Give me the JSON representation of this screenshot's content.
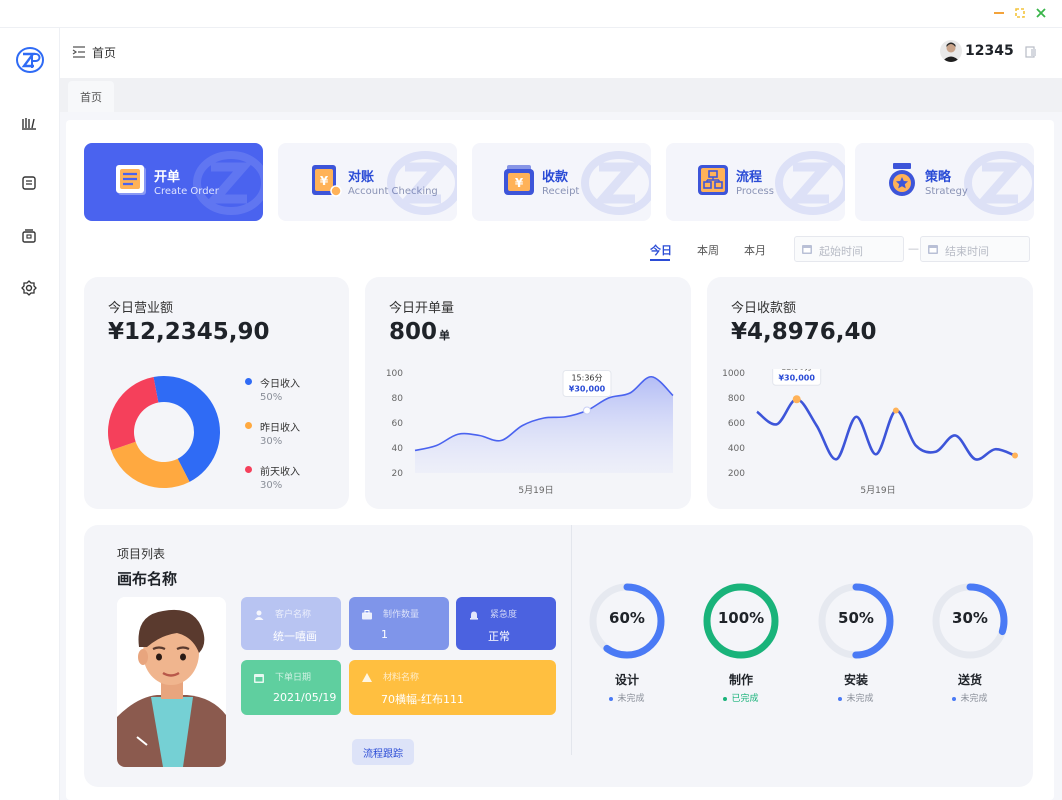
{
  "header": {
    "breadcrumb": "首页",
    "username": "12345"
  },
  "tabs": [
    {
      "label": "首页"
    }
  ],
  "quick_actions": [
    {
      "title": "开单",
      "subtitle": "Create Order",
      "active": true
    },
    {
      "title": "对账",
      "subtitle": "Account Checking",
      "active": false
    },
    {
      "title": "收款",
      "subtitle": "Receipt",
      "active": false
    },
    {
      "title": "流程",
      "subtitle": "Process",
      "active": false
    },
    {
      "title": "策略",
      "subtitle": "Strategy",
      "active": false
    }
  ],
  "period": {
    "today": "今日",
    "week": "本周",
    "month": "本月",
    "selected": "今日"
  },
  "date_range": {
    "start_placeholder": "起始时间",
    "separator": "—",
    "end_placeholder": "结束时间"
  },
  "stats": {
    "revenue": {
      "title": "今日营业额",
      "value": "¥12,2345,90"
    },
    "orders": {
      "title": "今日开单量",
      "value": "800",
      "unit": "单"
    },
    "receipts": {
      "title": "今日收款额",
      "value": "¥4,8976,40"
    }
  },
  "chart_data": [
    {
      "type": "pie",
      "title": "今日营业额",
      "donut": true,
      "slices": [
        {
          "label": "今日收入",
          "percent_label": "50%",
          "value": 50,
          "color": "#2f6bf5"
        },
        {
          "label": "昨日收入",
          "percent_label": "30%",
          "value": 30,
          "color": "#ffa940"
        },
        {
          "label": "前天收入",
          "percent_label": "30%",
          "value": 30,
          "color": "#f5405b"
        }
      ]
    },
    {
      "type": "area",
      "title": "今日开单量",
      "ylim": [
        20,
        100
      ],
      "yticks": [
        100,
        80,
        60,
        40,
        20
      ],
      "xlabel": "5月19日",
      "values": [
        38,
        42,
        51,
        50,
        46,
        58,
        64,
        65,
        70,
        80,
        84,
        97,
        82
      ],
      "tooltip": {
        "time": "15:36分",
        "value": "¥30,000",
        "index": 8
      },
      "color": "#4a63ef"
    },
    {
      "type": "line",
      "title": "今日收款额",
      "ylim": [
        200,
        1000
      ],
      "yticks": [
        1000,
        800,
        600,
        400,
        200
      ],
      "xlabel": "5月19日",
      "values": [
        690,
        590,
        790,
        580,
        310,
        650,
        350,
        700,
        420,
        370,
        500,
        310,
        390,
        340
      ],
      "tooltip": {
        "time": "12:50分",
        "value": "¥30,000",
        "index": 2
      },
      "color": "#3d55d9"
    }
  ],
  "project": {
    "section_title": "项目列表",
    "name": "画布名称",
    "fields": {
      "customer": {
        "label": "客户名称",
        "value": "统一嘻画"
      },
      "quantity": {
        "label": "制作数量",
        "value": "1"
      },
      "urgency": {
        "label": "紧急度",
        "value": "正常"
      },
      "order_date": {
        "label": "下单日期",
        "value": "2021/05/19"
      },
      "material": {
        "label": "材料名称",
        "value": "70横幅-红布111"
      }
    },
    "track_button": "流程跟踪",
    "progress": [
      {
        "name": "设计",
        "percent": 60,
        "percent_label": "60%",
        "status": "未完成",
        "color": "#4a7af5",
        "status_color": "#4a7af5"
      },
      {
        "name": "制作",
        "percent": 100,
        "percent_label": "100%",
        "status": "已完成",
        "color": "#19b37a",
        "status_color": "#19b37a"
      },
      {
        "name": "安装",
        "percent": 50,
        "percent_label": "50%",
        "status": "未完成",
        "color": "#4a7af5",
        "status_color": "#4a7af5"
      },
      {
        "name": "送货",
        "percent": 30,
        "percent_label": "30%",
        "status": "未完成",
        "color": "#4a7af5",
        "status_color": "#4a7af5"
      }
    ]
  }
}
